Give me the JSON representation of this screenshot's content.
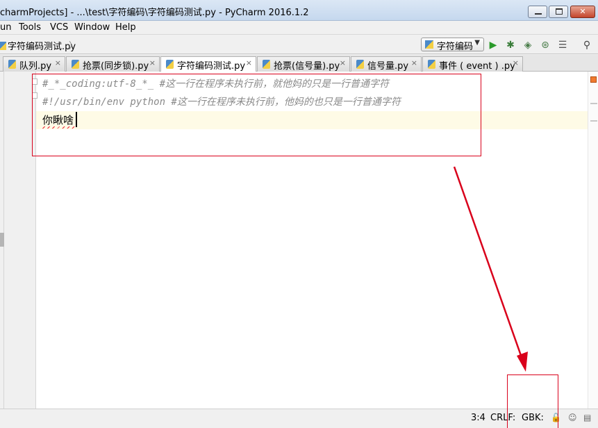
{
  "window": {
    "title": "charmProjects] - ...\\test\\字符编码\\字符编码测试.py - PyCharm 2016.1.2",
    "controls": {
      "minimize": "minimize",
      "maximize": "maximize",
      "close": "✕"
    }
  },
  "menu": {
    "items": [
      "un",
      "Tools",
      "VCS",
      "Window",
      "Help"
    ]
  },
  "navbar": {
    "breadcrumb": "字符编码测试.py",
    "run_config": "字符编码",
    "icons": [
      "run-icon",
      "debug-icon",
      "coverage-icon",
      "profile-icon",
      "tasks-icon",
      "search-icon"
    ]
  },
  "tabs": [
    {
      "label": "队列.py",
      "close": "×"
    },
    {
      "label": "抢票(同步锁).py",
      "close": "×"
    },
    {
      "label": "字符编码测试.py",
      "close": "×",
      "active": true
    },
    {
      "label": "抢票(信号量).py",
      "close": "×"
    },
    {
      "label": "信号量.py",
      "close": "×"
    },
    {
      "label": "事件 ( event ) .py",
      "close": "×"
    }
  ],
  "editor": {
    "lines": [
      "#_*_coding:utf-8_*_ #这一行在程序未执行前，就他妈的只是一行普通字符",
      "#!/usr/bin/env python #这一行在程序未执行前，他妈的也只是一行普通字符",
      "你瞅啥"
    ]
  },
  "status": {
    "cursor": "3:4",
    "line_separator": "CRLF:",
    "encoding": "GBK:",
    "icons": [
      "lock-icon",
      "inspector-icon",
      "event-log-icon"
    ]
  },
  "colors": {
    "annotation": "#d9001b",
    "comment": "#8a8a8a",
    "current_line": "#fefbe6"
  }
}
